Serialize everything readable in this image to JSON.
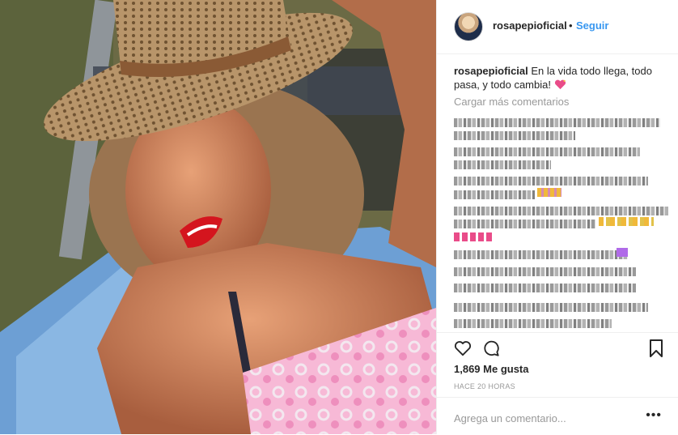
{
  "post": {
    "username": "rosapepioficial",
    "separator": "•",
    "follow_label": "Seguir",
    "caption_user": "rosapepioficial",
    "caption_text": "En la vida todo llega, todo pasa, y todo cambia! ",
    "caption_emoji": "sparkling-heart-icon",
    "load_more": "Cargar más comentarios",
    "likes": "1,869 Me gusta",
    "time": "HACE 20 HORAS",
    "comment_placeholder": "Agrega un comentario...",
    "options_glyph": "•••"
  },
  "icons": {
    "like": "heart-outline-icon",
    "comment": "comment-bubble-icon",
    "save": "bookmark-icon",
    "options": "more-options-icon"
  },
  "colors": {
    "link": "#3897f0",
    "muted": "#999999",
    "text": "#262626",
    "heart": "#e94c89"
  }
}
